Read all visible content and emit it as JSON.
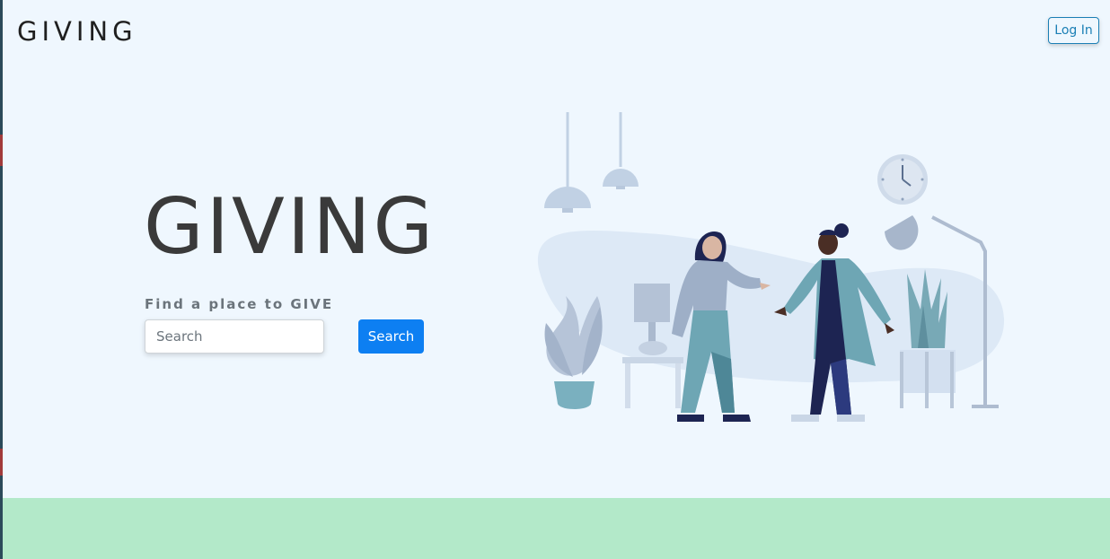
{
  "header": {
    "brand": "GIVING",
    "login_label": "Log In"
  },
  "hero": {
    "title": "GIVING",
    "subtitle": "Find a place to GIVE",
    "search": {
      "placeholder": "Search",
      "value": ""
    },
    "search_button_label": "Search"
  },
  "colors": {
    "page_background": "#eff7fe",
    "accent_blue": "#0d7ff2",
    "login_border": "#1b7fb5",
    "footer_band": "#b3e9c9"
  }
}
